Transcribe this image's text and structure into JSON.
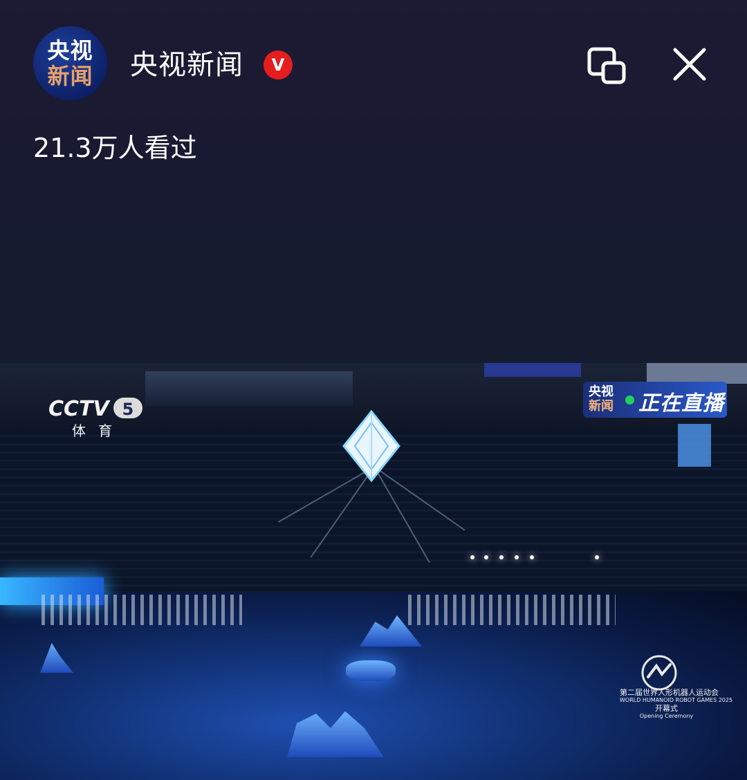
{
  "header": {
    "avatar_line1": "央视",
    "avatar_line2": "新闻",
    "channel_name": "央视新闻",
    "verified_badge": "V",
    "views_text": "21.3万人看过"
  },
  "icons": {
    "pip": "picture-in-picture-icon",
    "close": "close-icon"
  },
  "video": {
    "broadcaster_logo": "CCTV",
    "broadcaster_channel": "5",
    "broadcaster_sub": "体育",
    "live_logo_line1": "央视",
    "live_logo_line2": "新闻",
    "live_text": "正在直播",
    "live_dot_color": "#22d35a",
    "event_title": "第二届世界人形机器人运动会",
    "event_title_en": "WORLD HUMANOID ROBOT GAMES 2025",
    "event_sub": "开幕式",
    "event_sub_en": "Opening Ceremony"
  },
  "colors": {
    "verified_red": "#e41e1e",
    "top_background": "#1b1b33"
  }
}
